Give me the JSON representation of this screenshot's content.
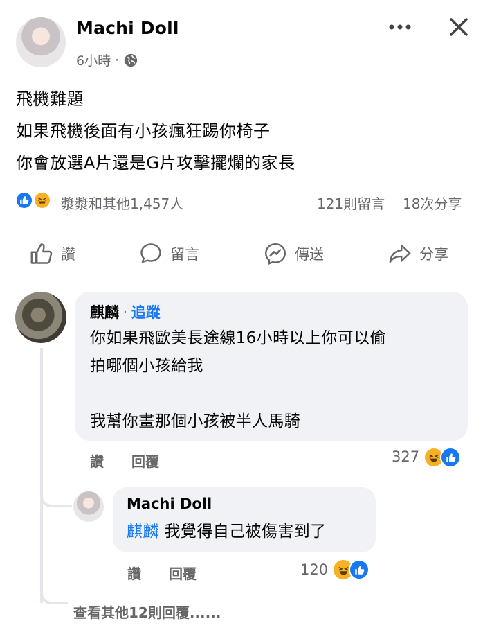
{
  "post": {
    "author": "Machi Doll",
    "time": "6小時",
    "separator": "·",
    "lines": [
      "飛機難題",
      "如果飛機後面有小孩瘋狂踢你椅子",
      "你會放選A片還是G片攻擊擺爛的家長"
    ],
    "reactions_summary": "漿漿和其他1,457人",
    "comments_count": "121則留言",
    "shares_count": "18次分享"
  },
  "actions": {
    "like": "讚",
    "comment": "留言",
    "send": "傳送",
    "share": "分享"
  },
  "comment": {
    "author": "麒麟",
    "separator": "·",
    "follow": "追蹤",
    "lines": [
      "你如果飛歐美長途線16小時以上你可以偷",
      "拍哪個小孩給我",
      "",
      "我幫你畫那個小孩被半人馬騎"
    ],
    "like_label": "讚",
    "reply_label": "回覆",
    "reaction_count": "327"
  },
  "reply": {
    "author": "Machi Doll",
    "mention": "麒麟",
    "text": "我覺得自己被傷害到了",
    "like_label": "讚",
    "reply_label": "回覆",
    "reaction_count": "120"
  },
  "more_replies": "查看其他12則回覆......",
  "icons": {
    "more": "more-horizontal-icon",
    "close": "close-icon",
    "privacy": "globe-icon",
    "like_reaction": "like-reaction-icon",
    "haha_reaction": "haha-reaction-icon"
  },
  "colors": {
    "brand_blue": "#1877f2",
    "secondary_text": "#65676b",
    "bubble_bg": "#f0f2f5",
    "haha_yellow": "#f7b125"
  }
}
